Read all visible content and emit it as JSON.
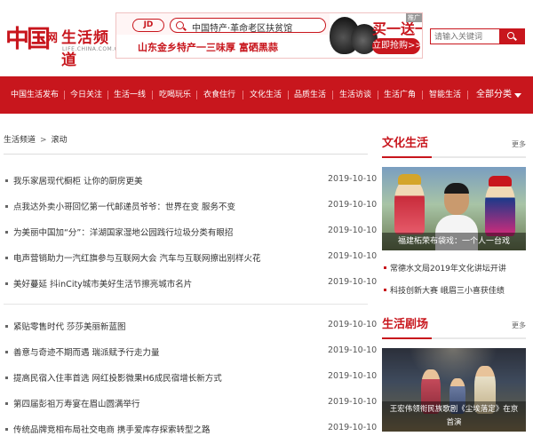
{
  "header": {
    "logo_mark": "中国",
    "logo_wang": "网",
    "logo_channel": "生活频道",
    "logo_sub": "LIFE.CHINA.COM.CN",
    "search_placeholder": "请输入关键词"
  },
  "ad": {
    "jd": "JD",
    "search_text": "中国特产·革命老区扶贫馆",
    "line2": "山东金乡特产一三味厚 富硒黑蒜",
    "promo1": "买一送一",
    "promo2": "立即抢购>>",
    "tag": "推广"
  },
  "nav": {
    "items": [
      "中国生活发布",
      "今日关注",
      "生活一线",
      "吃喝玩乐",
      "衣食住行",
      "文化生活",
      "品质生活",
      "生活访谈",
      "生活广角",
      "智能生活"
    ],
    "all_label": "全部分类"
  },
  "breadcrumb": {
    "channel": "生活频道",
    "sep": ">",
    "current": "滚动"
  },
  "news": [
    {
      "title": "我乐家居现代橱柜 让你的厨房更美",
      "date": "2019-10-10"
    },
    {
      "title": "点我达外卖小哥回忆第一代邮递员爷爷：世界在变 服务不变",
      "date": "2019-10-10"
    },
    {
      "title": "为美丽中国加“分”：洋湖国家湿地公园践行垃圾分类有眼招",
      "date": "2019-10-10"
    },
    {
      "title": "电声营销助力一汽红旗参与互联网大会 汽车与互联网擦出别样火花",
      "date": "2019-10-10"
    },
    {
      "title": "美好蔓延 抖inCity城市美好生活节擦亮城市名片",
      "date": "2019-10-10"
    },
    {
      "title": "紧贴零售时代 莎莎美丽新蓝图",
      "date": "2019-10-10"
    },
    {
      "title": "善意与奇迹不期而遇 瑞派赋予行走力量",
      "date": "2019-10-10"
    },
    {
      "title": "提高民宿入住率首选 网红投影微果H6成民宿增长新方式",
      "date": "2019-10-10"
    },
    {
      "title": "第四届彭祖万寿宴在眉山圆满举行",
      "date": "2019-10-10"
    },
    {
      "title": "传统品牌竞相布局社交电商 携手爱库存探索转型之路",
      "date": "2019-10-10"
    }
  ],
  "sidebar": {
    "culture": {
      "title": "文化生活",
      "more": "更多",
      "photo_caption": "福建柘荣布袋戏：一个人一台戏",
      "items": [
        "常德水文局2019年文化讲坛开讲",
        "科技创新大赛 峨眉三小喜获佳绩"
      ]
    },
    "theater": {
      "title": "生活剧场",
      "more": "更多",
      "photo_caption_line1": "王宏伟领衔民族歌剧《尘埃落定》在京",
      "photo_caption_line2": "首演"
    }
  },
  "colors": {
    "brand_red": "#c8161d"
  }
}
